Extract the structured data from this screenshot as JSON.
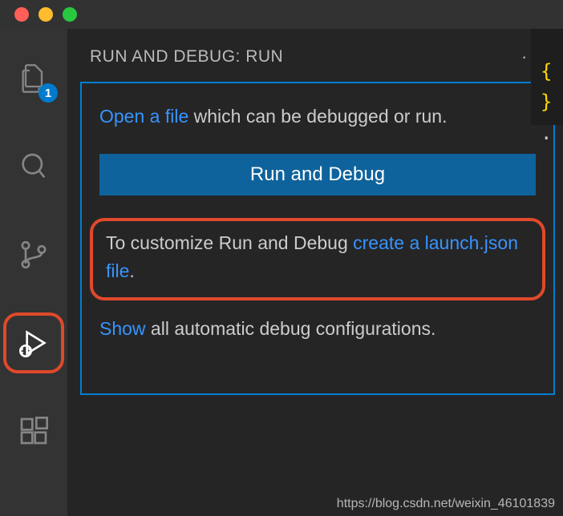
{
  "activityBar": {
    "explorerBadge": "1"
  },
  "sidebar": {
    "header": "RUN AND DEBUG: RUN",
    "moreLabel": "···"
  },
  "panel": {
    "openFileLink": "Open a file",
    "openFileRest": " which can be debugged or run.",
    "runDebugButton": "Run and Debug",
    "customizePrefix": "To customize Run and Debug ",
    "createLaunchLink": "create a launch.json file",
    "customizeSuffix": ".",
    "showLink": "Show",
    "showRest": " all automatic debug configurations."
  },
  "editorPeek": {
    "brace": "{ }",
    "continuation": "."
  },
  "watermark": "https://blog.csdn.net/weixin_46101839"
}
